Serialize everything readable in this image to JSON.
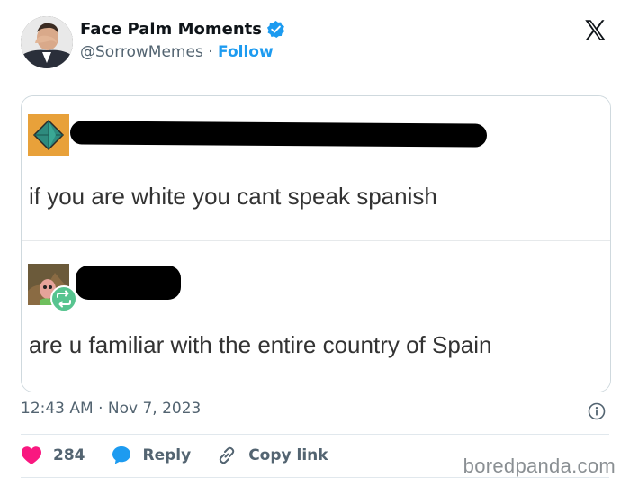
{
  "account": {
    "display_name": "Face Palm Moments",
    "handle": "@SorrowMemes",
    "separator": "·",
    "follow_label": "Follow"
  },
  "media": {
    "message_1": "if you are white you cant speak spanish",
    "message_2": "are u familiar with the entire country of Spain"
  },
  "timestamp": "12:43 AM · Nov 7, 2023",
  "actions": {
    "like_count": "284",
    "reply_label": "Reply",
    "copy_link_label": "Copy link"
  },
  "watermark": "boredpanda.com",
  "colors": {
    "link_blue": "#1d9bf0",
    "like_red": "#f91880",
    "retweet_green": "#57c48f",
    "muted_text": "#536471"
  }
}
